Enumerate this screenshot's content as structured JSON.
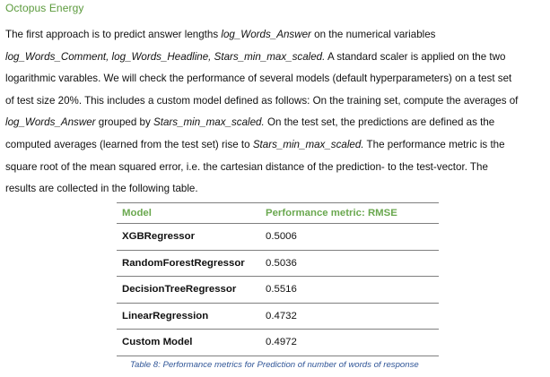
{
  "header": {
    "brand": "Octopus Energy"
  },
  "paragraph": {
    "lines": [
      [
        {
          "t": "The first approach is to predict answer lengths ",
          "i": false
        },
        {
          "t": "log_Words_Answer",
          "i": true
        },
        {
          "t": " on the numerical variables",
          "i": false
        }
      ],
      [
        {
          "t": "log_Words_Comment, log_Words_Headline, Stars_min_max_scaled.",
          "i": true
        },
        {
          "t": " A standard scaler is applied on the two",
          "i": false
        }
      ],
      [
        {
          "t": "logarithmic varables. We will check the performance of several models (default hyperparameters) on a test set",
          "i": false
        }
      ],
      [
        {
          "t": "of test size 20%. This includes a custom model defined as follows: On the training set, compute the averages of",
          "i": false
        }
      ],
      [
        {
          "t": "log_Words_Answer",
          "i": true
        },
        {
          "t": " grouped by ",
          "i": false
        },
        {
          "t": "Stars_min_max_scaled.",
          "i": true
        },
        {
          "t": " On the test set, the predictions are defined as the",
          "i": false
        }
      ],
      [
        {
          "t": "computed averages (learned from the test set) rise to ",
          "i": false
        },
        {
          "t": "Stars_min_max_scaled.",
          "i": true
        },
        {
          "t": " The performance metric is the",
          "i": false
        }
      ],
      [
        {
          "t": "square root of the mean squared error, i.e. the cartesian distance of the prediction- to the test-vector. The",
          "i": false
        }
      ],
      [
        {
          "t": "results are collected in the following table.",
          "i": false
        }
      ]
    ]
  },
  "table": {
    "columns": {
      "model": "Model",
      "metric": "Performance metric: RMSE"
    },
    "rows": [
      {
        "model": "XGBRegressor",
        "metric": "0.5006"
      },
      {
        "model": "RandomForestRegressor",
        "metric": "0.5036"
      },
      {
        "model": "DecisionTreeRegressor",
        "metric": "0.5516"
      },
      {
        "model": "LinearRegression",
        "metric": "0.4732"
      },
      {
        "model": "Custom Model",
        "metric": "0.4972"
      }
    ],
    "caption": "Table 8: Performance metrics for Prediction of number of words of response"
  }
}
